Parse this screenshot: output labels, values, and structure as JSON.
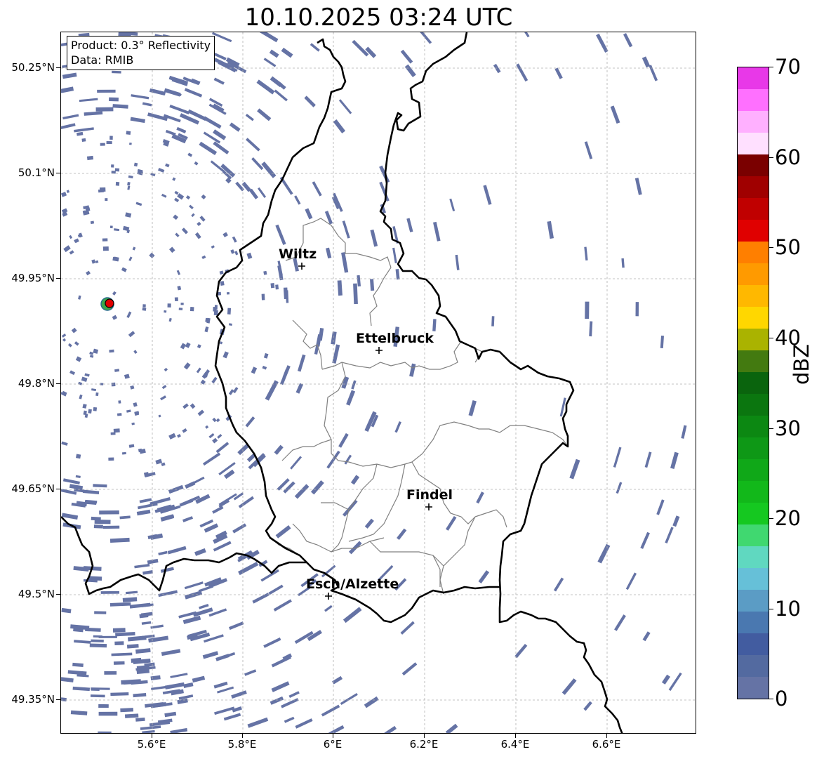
{
  "title": "10.10.2025 03:24 UTC",
  "info": {
    "product": "Product: 0.3° Reflectivity",
    "data": "Data: RMIB"
  },
  "y_ticks": [
    "50.25°N",
    "50.1°N",
    "49.95°N",
    "49.8°N",
    "49.65°N",
    "49.5°N",
    "49.35°N"
  ],
  "x_ticks": [
    "5.6°E",
    "5.8°E",
    "6°E",
    "6.2°E",
    "6.4°E",
    "6.6°E"
  ],
  "cities": [
    {
      "name": "Wiltz",
      "marker": "+"
    },
    {
      "name": "Ettelbruck",
      "marker": "+"
    },
    {
      "name": "Findel",
      "marker": "+"
    },
    {
      "name": "Esch/Alzette",
      "marker": "+"
    }
  ],
  "radar_site_color": "#e00000",
  "colorbar": {
    "unit": "dBZ",
    "tick_labels": [
      "0",
      "10",
      "20",
      "30",
      "40",
      "50",
      "60",
      "70"
    ],
    "range": [
      0,
      70
    ],
    "step": 2.5,
    "colors": [
      "#6573a5",
      "#536aa0",
      "#425ca0",
      "#4a78b0",
      "#5b9cc5",
      "#66c0d8",
      "#60d8c0",
      "#40d870",
      "#15c820",
      "#12b81a",
      "#10a818",
      "#0e9816",
      "#0c8812",
      "#0b760f",
      "#0a640d",
      "#437a10",
      "#aab300",
      "#ffd700",
      "#ffb800",
      "#ff9a00",
      "#ff7f00",
      "#e00000",
      "#c00000",
      "#a00000",
      "#7a0000",
      "#ffe0ff",
      "#ffb0ff",
      "#ff70ff",
      "#e838e8"
    ]
  }
}
